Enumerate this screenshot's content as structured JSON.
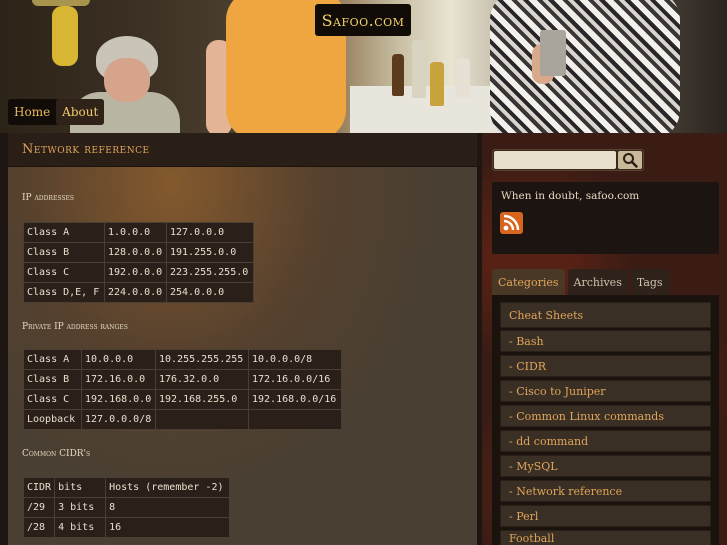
{
  "site": {
    "title": "Safoo.com"
  },
  "nav": {
    "items": [
      {
        "label": "Home"
      },
      {
        "label": "About"
      }
    ]
  },
  "post": {
    "title": "Network reference",
    "sections": [
      {
        "heading": "IP addresses",
        "rows": [
          [
            "Class A",
            "1.0.0.0",
            "127.0.0.0"
          ],
          [
            "Class B",
            "128.0.0.0",
            "191.255.0.0"
          ],
          [
            "Class C",
            "192.0.0.0",
            "223.255.255.0"
          ],
          [
            "Class D,E, F",
            "224.0.0.0",
            "254.0.0.0"
          ]
        ]
      },
      {
        "heading": "Private IP address ranges",
        "rows": [
          [
            "Class A",
            "10.0.0.0",
            "10.255.255.255",
            "10.0.0.0/8"
          ],
          [
            "Class B",
            "172.16.0.0",
            "176.32.0.0",
            "172.16.0.0/16"
          ],
          [
            "Class C",
            "192.168.0.0",
            "192.168.255.0",
            "192.168.0.0/16"
          ],
          [
            "Loopback",
            "127.0.0.0/8",
            "",
            ""
          ]
        ]
      },
      {
        "heading": "Common CIDR's",
        "rows": [
          [
            "CIDR",
            "bits",
            "Hosts (remember -2)"
          ],
          [
            "/29",
            "3 bits",
            "8"
          ],
          [
            "/28",
            "4 bits",
            "16"
          ]
        ]
      }
    ]
  },
  "sidebar": {
    "search": {
      "placeholder": "",
      "value": ""
    },
    "tagline": "When in doubt, safoo.com",
    "tabs": [
      {
        "label": "Categories"
      },
      {
        "label": "Archives"
      },
      {
        "label": "Tags"
      }
    ],
    "categories": [
      "Cheat Sheets",
      "- Bash",
      "- CIDR",
      "- Cisco to Juniper",
      "- Common Linux commands",
      "- dd command",
      "- MySQL",
      "- Network reference",
      "- Perl",
      "Football"
    ]
  },
  "colors": {
    "accent": "#e0a55a",
    "title": "#f4d36a",
    "rss": "#d9641e"
  }
}
